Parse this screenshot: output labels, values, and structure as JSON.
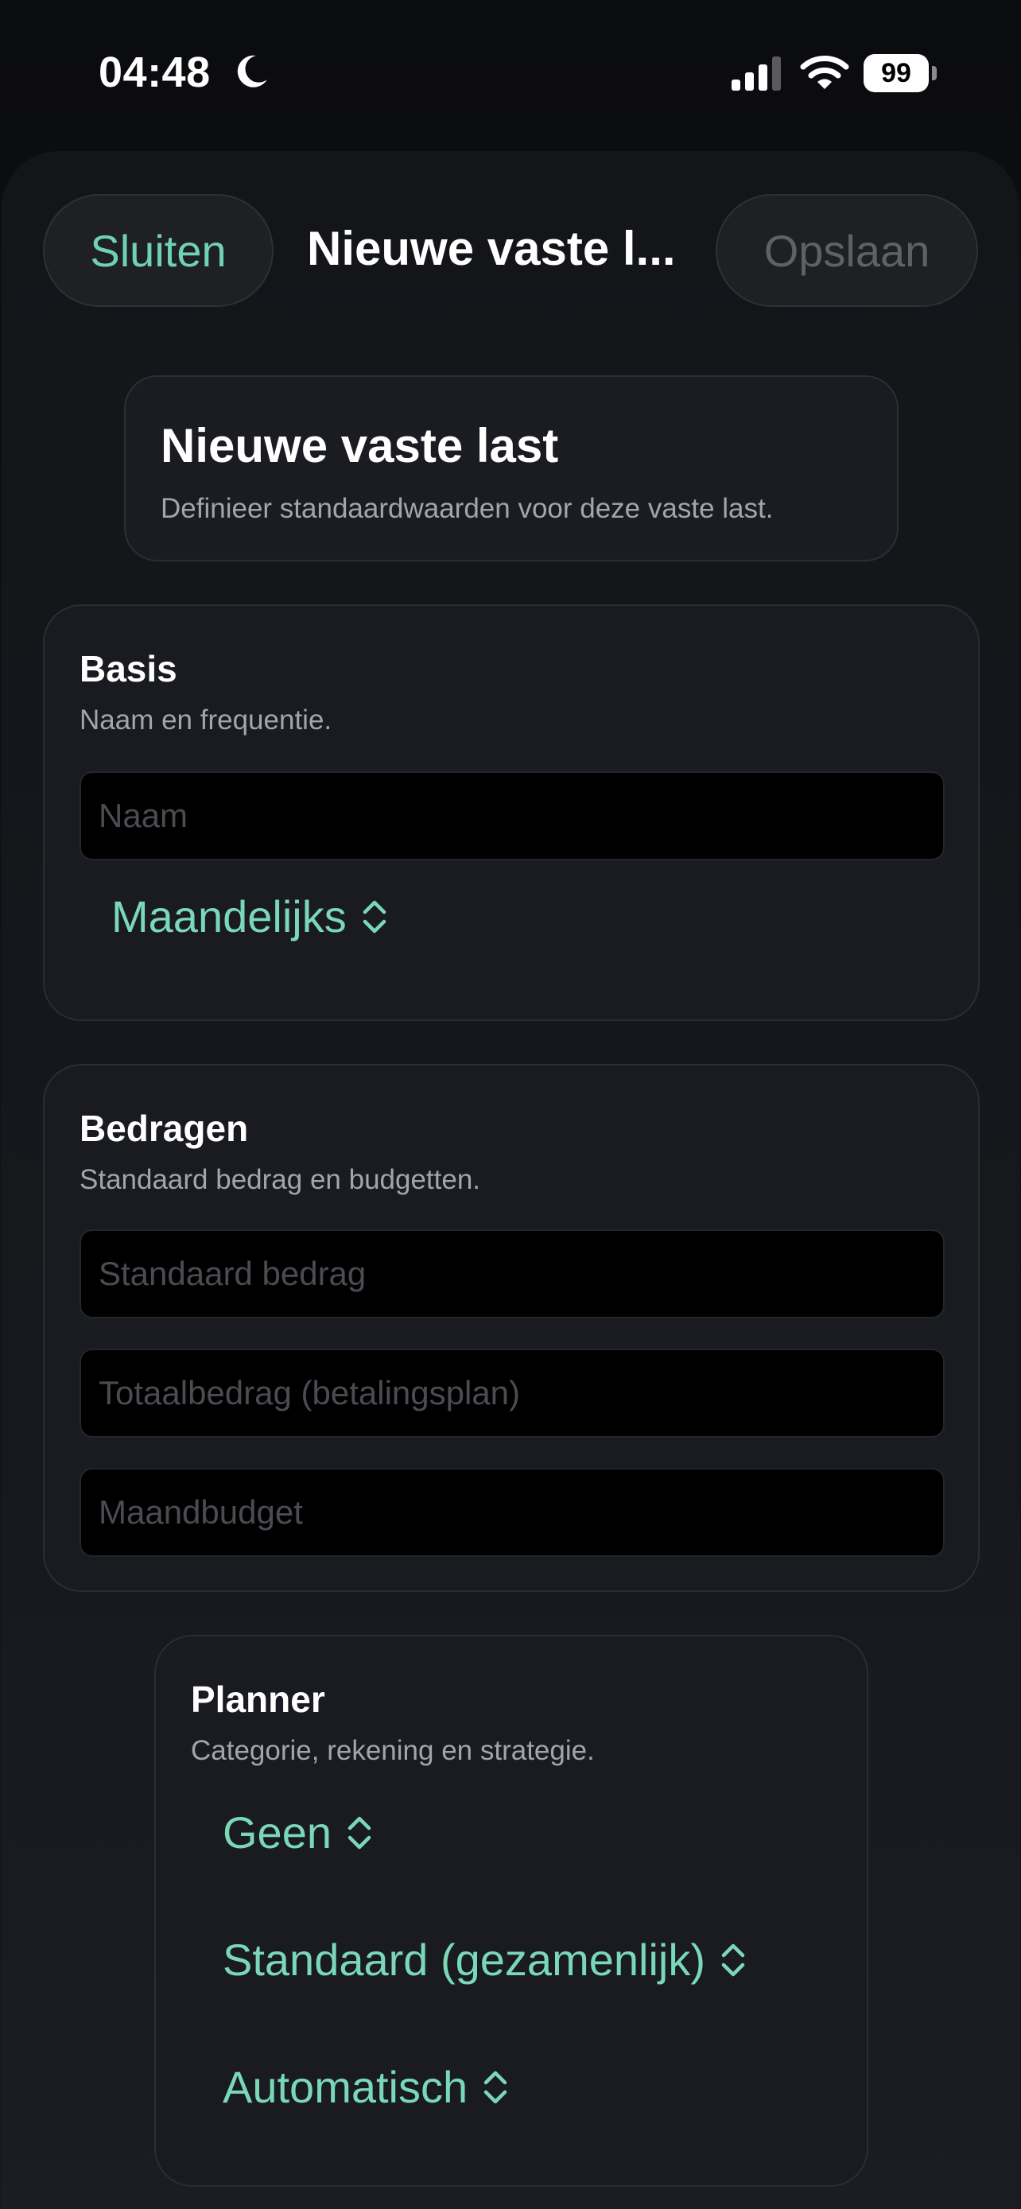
{
  "status_bar": {
    "time": "04:48",
    "battery": "99",
    "icons": [
      "moon-icon",
      "cellular-signal-icon",
      "wifi-icon",
      "battery-icon"
    ]
  },
  "nav": {
    "close_label": "Sluiten",
    "title": "Nieuwe vaste l...",
    "save_label": "Opslaan"
  },
  "intro": {
    "title": "Nieuwe vaste last",
    "subtitle": "Definieer standaardwaarden voor deze vaste last."
  },
  "basis": {
    "title": "Basis",
    "subtitle": "Naam en frequentie.",
    "name_value": "",
    "name_placeholder": "Naam",
    "frequency": "Maandelijks"
  },
  "amounts": {
    "title": "Bedragen",
    "subtitle": "Standaard bedrag en budgetten.",
    "standard_value": "",
    "standard_placeholder": "Standaard bedrag",
    "total_value": "",
    "total_placeholder": "Totaalbedrag (betalingsplan)",
    "budget_value": "",
    "budget_placeholder": "Maandbudget"
  },
  "planner": {
    "title": "Planner",
    "subtitle": "Categorie, rekening en strategie.",
    "category": "Geen",
    "account": "Standaard (gezamenlijk)",
    "strategy": "Automatisch"
  },
  "colors": {
    "accent": "#7ad8b8",
    "background": "#0b0c0f",
    "card": "#191b20",
    "muted_text": "#a3a5ab",
    "disabled_text": "#5f6166"
  }
}
